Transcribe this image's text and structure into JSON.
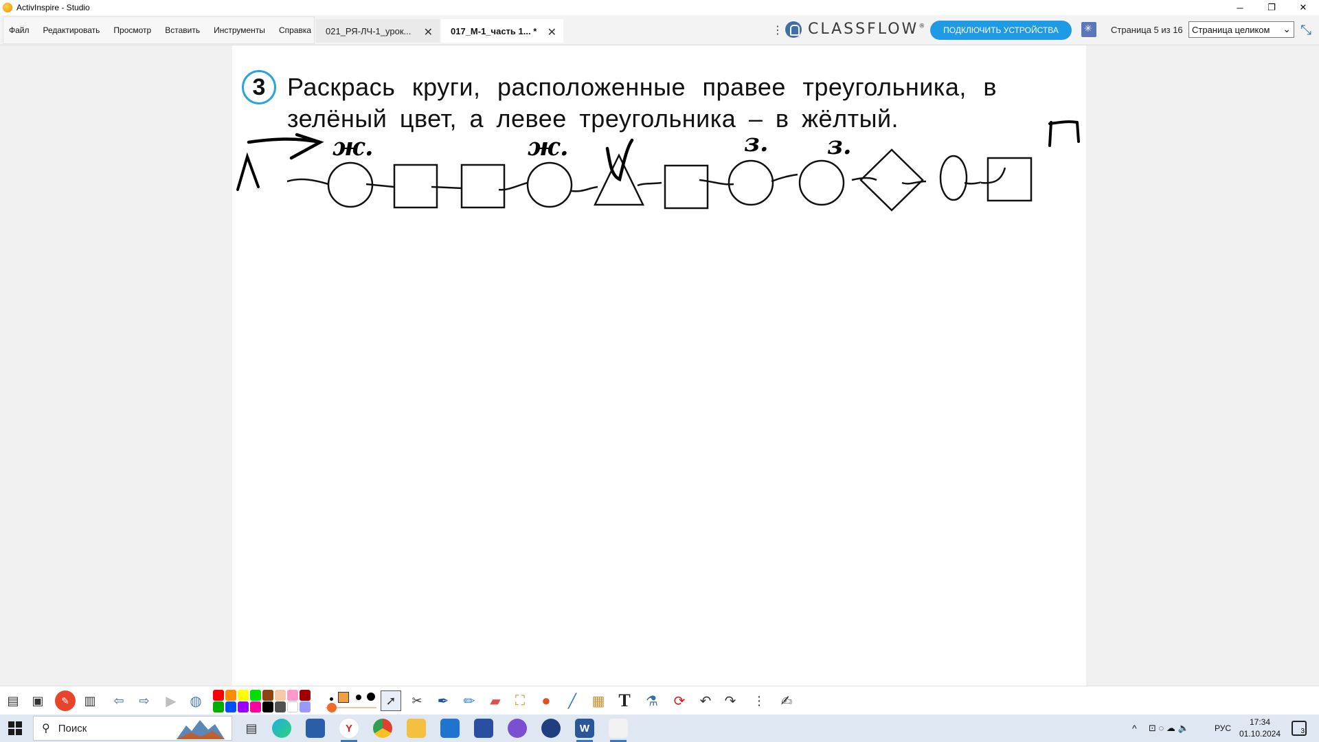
{
  "window": {
    "title": "ActivInspire - Studio",
    "minimize": "─",
    "restore": "❐",
    "close": "✕"
  },
  "menu": [
    "Файл",
    "Редактировать",
    "Просмотр",
    "Вставить",
    "Инструменты",
    "Справка"
  ],
  "tabs": [
    {
      "label": "021_РЯ-ЛЧ-1_урок...",
      "close": "✕"
    },
    {
      "label": "017_М-1_часть 1... *",
      "close": "✕"
    }
  ],
  "header": {
    "kebab": "⋮",
    "classflow_logo": "CLASSFLOW",
    "classflow_reg": "®",
    "connect_button": "ПОДКЛЮЧИТЬ УСТРОЙСТВА",
    "page_counter": "Страница 5 из 16",
    "view_select": "Страница целиком",
    "view_chevron": "⌄",
    "fullscreen": "⤡"
  },
  "page": {
    "task_number": "3",
    "task_line1": "Раскрась круги, расположенные правее треугольника, в",
    "task_line2": "зелёный цвет, а левее треугольника – в жёлтый.",
    "annotations": {
      "left_mark": "Л",
      "right_mark": "П",
      "yellow_1": "ж.",
      "yellow_2": "ж.",
      "green_1": "з.",
      "green_2": "з."
    },
    "shapes": [
      "circle",
      "square",
      "square",
      "circle",
      "triangle",
      "square",
      "circle",
      "circle",
      "diamond",
      "ellipse",
      "square"
    ]
  },
  "toolbar": {
    "colors": [
      "#ff0000",
      "#ff8c00",
      "#ffff00",
      "#00e000",
      "#8b4513",
      "#f5c9a8",
      "#ff99cc",
      "#a00000",
      "#00b000",
      "#0050ff",
      "#9b00ff",
      "#ff00a0",
      "#000000",
      "#505050",
      "#ffffff",
      "#9999ff"
    ],
    "text_tool": "T"
  },
  "taskbar": {
    "search_placeholder": "Поиск",
    "search_icon": "⚲",
    "lang": "РУС",
    "time": "17:34",
    "date": "01.10.2024",
    "notifications": "3",
    "yandex_letter": "Y",
    "word_letter": "W",
    "tray_chevron": "^",
    "tray_icons": "⊡ ◌ ☁ 🔈"
  }
}
